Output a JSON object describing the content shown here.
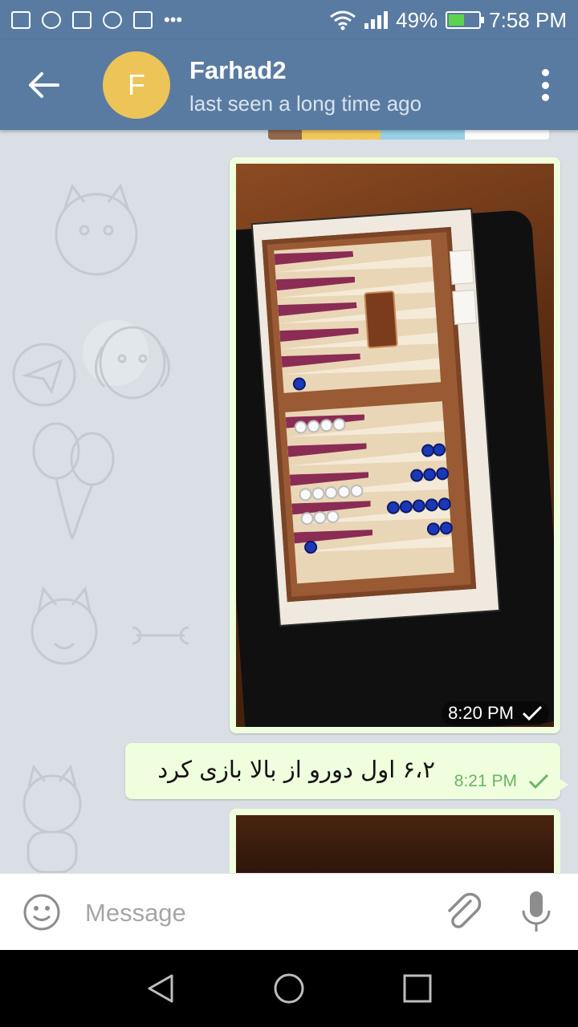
{
  "status_bar": {
    "battery": "49%",
    "time": "7:58 PM",
    "icons": [
      "gallery-icon",
      "sync-icon",
      "image-icon",
      "loading-icon",
      "media-icon",
      "more-dots-icon",
      "wifi-icon",
      "signal-icon",
      "battery-charging-icon"
    ]
  },
  "header": {
    "avatar_letter": "F",
    "name": "Farhad2",
    "status": "last seen a long time ago",
    "accent_color": "#5a7ba1",
    "avatar_color": "#edc458"
  },
  "messages": [
    {
      "type": "photo",
      "time": "8:20 PM",
      "status": "sent"
    },
    {
      "type": "text",
      "text": "۶،۲ اول دورو از بالا بازی کرد",
      "time": "8:21 PM",
      "status": "sent"
    },
    {
      "type": "photo",
      "time": "",
      "status": ""
    }
  ],
  "input": {
    "placeholder": "Message"
  },
  "colors": {
    "outgoing_bubble": "#effedd",
    "check_green": "#6ab466"
  }
}
